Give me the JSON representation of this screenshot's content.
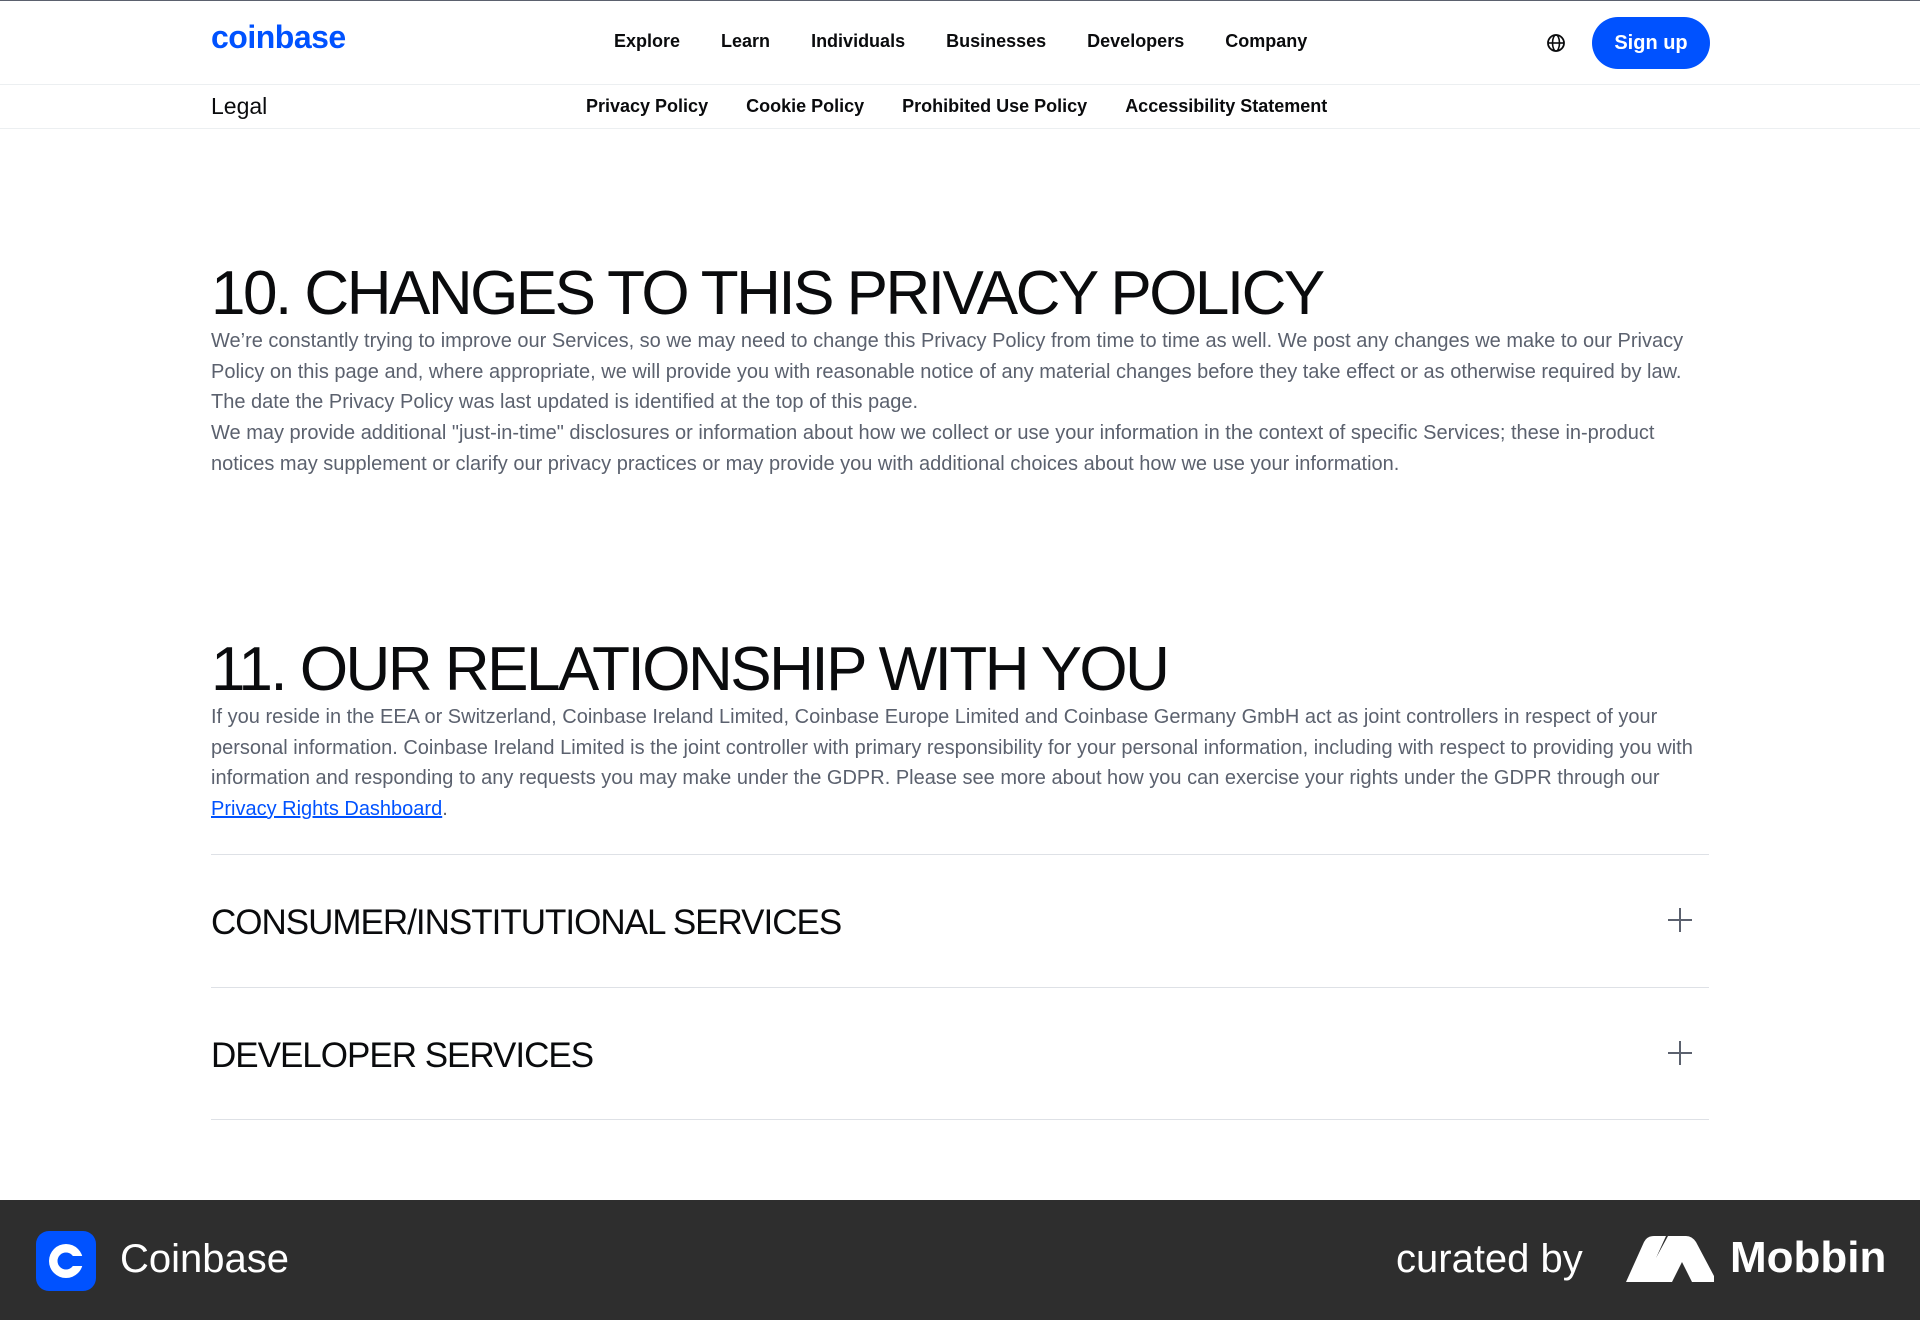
{
  "brand": {
    "logo_text": "coinbase",
    "accent": "#0052ff"
  },
  "nav": {
    "items": [
      "Explore",
      "Learn",
      "Individuals",
      "Businesses",
      "Developers",
      "Company"
    ],
    "signup_label": "Sign up"
  },
  "subnav": {
    "title": "Legal",
    "links": [
      "Privacy Policy",
      "Cookie Policy",
      "Prohibited Use Policy",
      "Accessibility Statement"
    ]
  },
  "sections": [
    {
      "heading": "10. CHANGES TO THIS PRIVACY POLICY",
      "para1": "We’re constantly trying to improve our Services, so we may need to change this Privacy Policy from time to time as well. We post any changes we make to our Privacy Policy on this page and, where appropriate, we will provide you with reasonable notice of any material changes before they take effect or as otherwise required by law. The date the Privacy Policy was last updated is identified at the top of this page.",
      "para2": "We may provide additional \"just-in-time\" disclosures or information about how we collect or use your information in the context of specific Services; these in-product notices may supplement or clarify our privacy practices or may provide you with additional choices about how we use your information."
    },
    {
      "heading": "11. OUR RELATIONSHIP WITH YOU",
      "para1": "If you reside in the EEA or Switzerland, Coinbase Ireland Limited, Coinbase Europe Limited and Coinbase Germany GmbH act as joint controllers in respect of your personal information. Coinbase Ireland Limited is the joint controller with primary responsibility for your personal information, including with respect to providing you with information and responding to any requests you may make under the GDPR. Please see more about how you can  exercise your rights under the GDPR through our ",
      "link": "Privacy Rights Dashboard",
      "para1_end": "."
    }
  ],
  "accordions": [
    "CONSUMER/INSTITUTIONAL SERVICES",
    "DEVELOPER SERVICES"
  ],
  "footer": {
    "app_name": "Coinbase",
    "curated_by": "curated by",
    "mobbin": "Mobbin"
  }
}
